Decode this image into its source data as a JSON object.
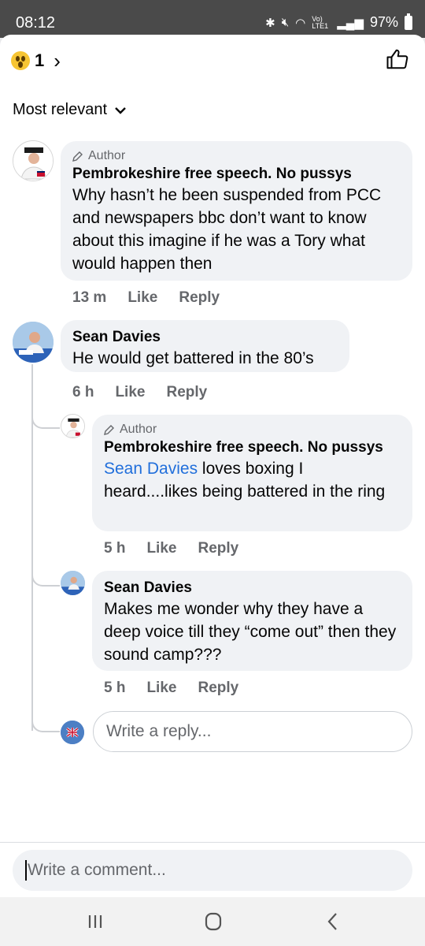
{
  "status": {
    "time": "08:12",
    "battery": "97%",
    "network": "Vo) LTE1"
  },
  "header": {
    "reaction_count": "1"
  },
  "sort": {
    "label": "Most relevant"
  },
  "comments": [
    {
      "author_tag": "Author",
      "name": "Pembrokeshire free speech. No pussys",
      "text": "Why hasn’t he been suspended from PCC and newspapers bbc don’t want to know about this imagine if he was a Tory what would happen then",
      "time": "13 m",
      "like": "Like",
      "reply": "Reply"
    },
    {
      "name": "Sean Davies",
      "text": "He would get battered in the 80’s",
      "time": "6 h",
      "like": "Like",
      "reply": "Reply"
    }
  ],
  "replies": [
    {
      "author_tag": "Author",
      "name": "Pembrokeshire free speech. No pussys",
      "mention": "Sean Davies",
      "text": " loves boxing I heard....likes being battered in the ring",
      "time": "5 h",
      "like": "Like",
      "reply": "Reply"
    },
    {
      "name": "Sean Davies",
      "text": "Makes me wonder why they have a deep voice till they “come out” then they sound camp???",
      "time": "5 h",
      "like": "Like",
      "reply": "Reply"
    }
  ],
  "reply_input": {
    "placeholder": "Write a reply..."
  },
  "comment_input": {
    "placeholder": "Write a comment..."
  },
  "icons": [
    "wow-reaction-icon",
    "chevron-right-icon",
    "thumbs-up-icon",
    "chevron-down-icon",
    "pencil-icon",
    "nav-recents-icon",
    "nav-home-icon",
    "nav-back-icon"
  ]
}
